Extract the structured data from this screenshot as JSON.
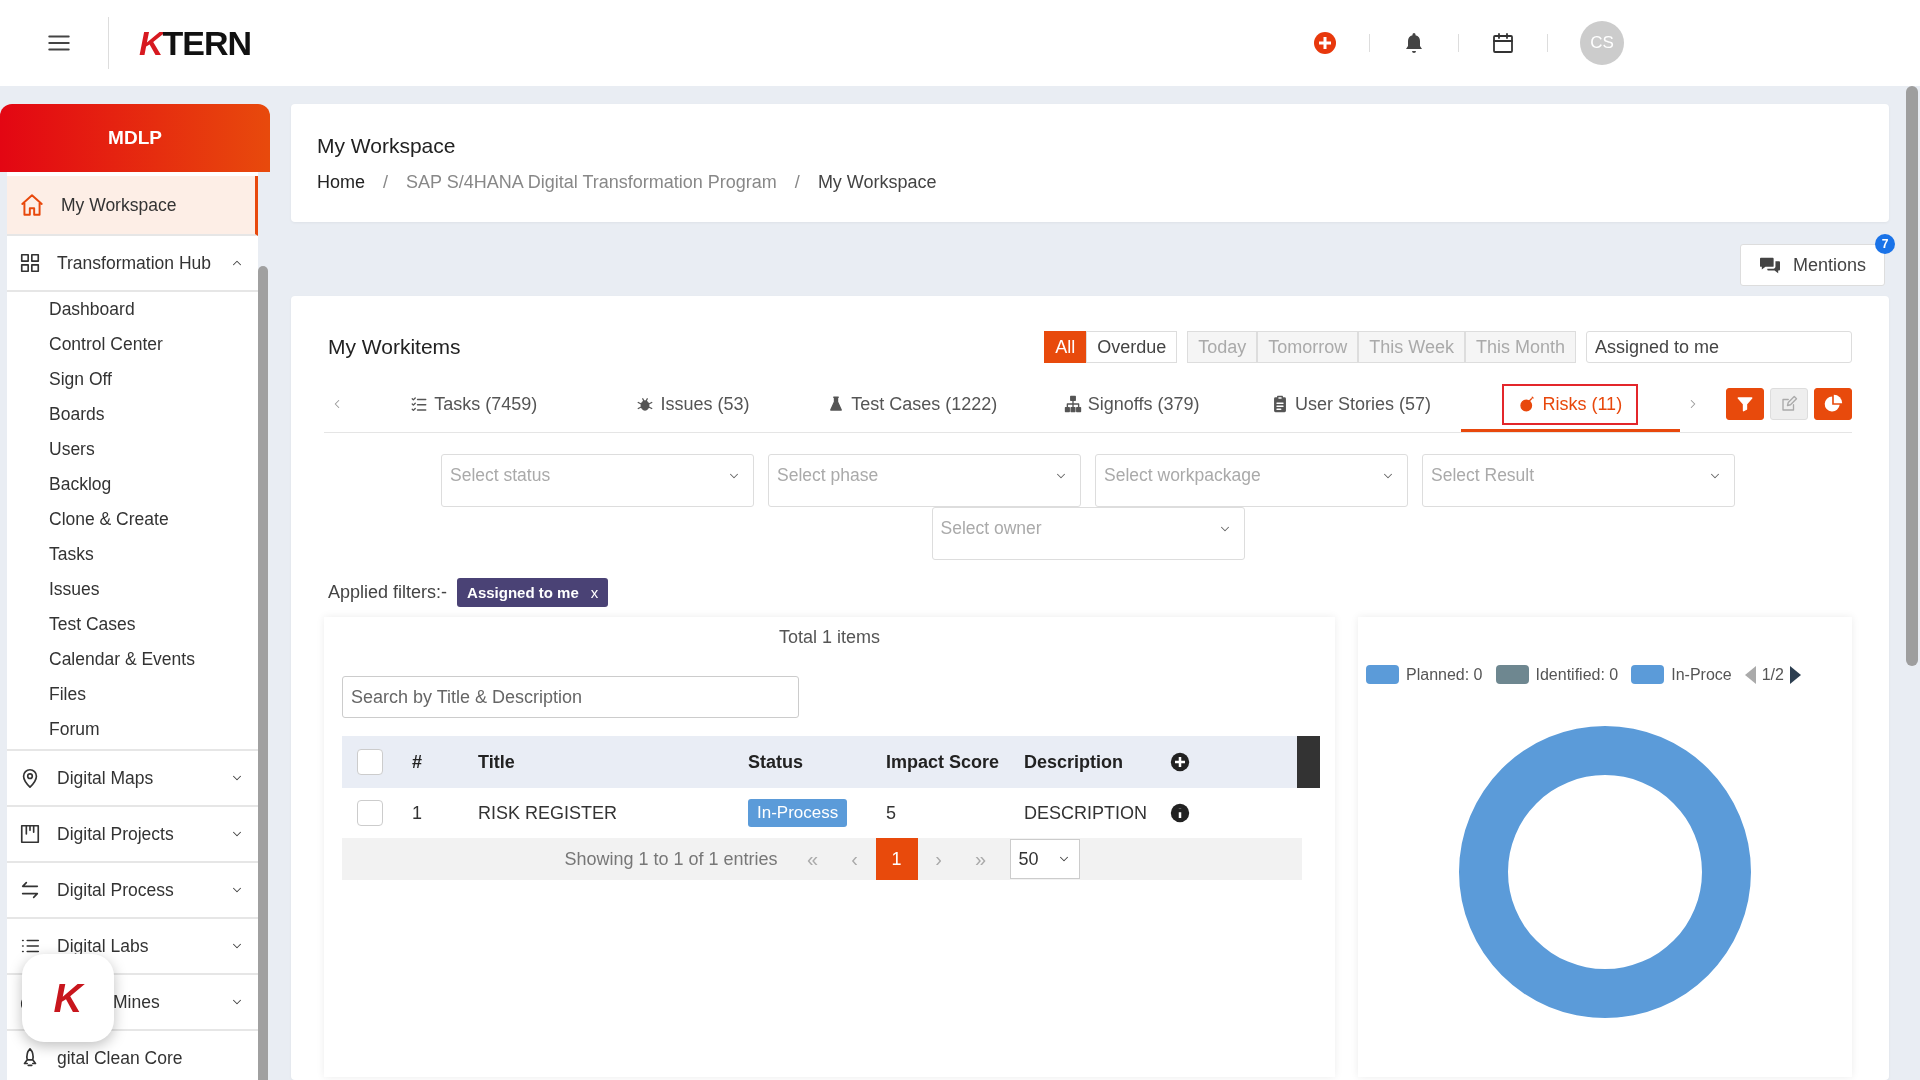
{
  "header": {
    "logo": "KTERN",
    "avatar": "CS"
  },
  "sidebar": {
    "brand": "MDLP",
    "items": [
      {
        "label": "My Workspace",
        "selected": true
      },
      {
        "label": "Transformation Hub",
        "selected": false,
        "expanded": true,
        "children": [
          {
            "label": "Dashboard",
            "selected": false
          },
          {
            "label": "Control Center",
            "selected": false
          },
          {
            "label": "Sign Off",
            "selected": false
          },
          {
            "label": "Boards",
            "selected": false
          },
          {
            "label": "Users",
            "selected": false
          },
          {
            "label": "Backlog",
            "selected": false
          },
          {
            "label": "Clone & Create",
            "selected": false
          },
          {
            "label": "Tasks",
            "selected": false
          },
          {
            "label": "Issues",
            "selected": false
          },
          {
            "label": "Test Cases",
            "selected": false
          },
          {
            "label": "Calendar & Events",
            "selected": false
          },
          {
            "label": "Files",
            "selected": false
          },
          {
            "label": "Forum",
            "selected": false
          }
        ]
      },
      {
        "label": "Digital Maps",
        "selected": false,
        "expanded": false
      },
      {
        "label": "Digital Projects",
        "selected": false,
        "expanded": false
      },
      {
        "label": "Digital Process",
        "selected": false,
        "expanded": false
      },
      {
        "label": "Digital Labs",
        "selected": false,
        "expanded": false
      },
      {
        "label": "Mines",
        "selected": false,
        "expanded": false
      },
      {
        "label": "gital Clean Core",
        "selected": false
      }
    ],
    "fab": "K"
  },
  "page": {
    "title": "My Workspace",
    "breadcrumb": [
      "Home",
      "SAP S/4HANA Digital Transformation Program",
      "My Workspace"
    ],
    "separator": "/"
  },
  "mentions": {
    "label": "Mentions",
    "badge": "7"
  },
  "workitems": {
    "title": "My Workitems",
    "due_filters": [
      {
        "label": "All",
        "selected": true
      },
      {
        "label": "Overdue",
        "selected": false
      }
    ],
    "range_filters": [
      {
        "label": "Today",
        "disabled": true
      },
      {
        "label": "Tomorrow",
        "disabled": true
      },
      {
        "label": "This Week",
        "disabled": true
      },
      {
        "label": "This Month",
        "disabled": true
      }
    ],
    "assignee": {
      "value": "Assigned to me"
    },
    "tabs": [
      {
        "label": "Tasks (7459)",
        "selected": false
      },
      {
        "label": "Issues (53)",
        "selected": false
      },
      {
        "label": "Test Cases (1222)",
        "selected": false
      },
      {
        "label": "Signoffs (379)",
        "selected": false
      },
      {
        "label": "User Stories (57)",
        "selected": false
      },
      {
        "label": "Risks (11)",
        "selected": true
      }
    ],
    "selects": [
      {
        "placeholder": "Select status"
      },
      {
        "placeholder": "Select phase"
      },
      {
        "placeholder": "Select workpackage"
      },
      {
        "placeholder": "Select Result"
      },
      {
        "placeholder": "Select owner"
      }
    ],
    "applied_filters": {
      "label": "Applied filters:-",
      "chips": [
        {
          "label": "Assigned to me",
          "close": "x"
        }
      ]
    },
    "total": "Total 1 items",
    "search": {
      "placeholder": "Search by Title & Description"
    },
    "table": {
      "header_checked": false,
      "columns": [
        "#",
        "Title",
        "Status",
        "Impact Score",
        "Description"
      ],
      "rows": [
        {
          "number": "1",
          "title": "RISK REGISTER",
          "status": "In-Process",
          "impact_score": "5",
          "description": "DESCRIPTION",
          "checked": false
        }
      ]
    },
    "pagination": {
      "summary": "Showing 1 to 1 of 1 entries",
      "first": "«",
      "prev": "‹",
      "pages": [
        {
          "label": "1",
          "selected": true
        }
      ],
      "next": "›",
      "last": "»",
      "page_size": "50"
    },
    "chart": {
      "legend": [
        {
          "label": "Planned: 0",
          "color": "#5b9bd9"
        },
        {
          "label": "Identified: 0",
          "color": "#6e8790"
        },
        {
          "label": "In-Proce",
          "color": "#5b9bd9"
        }
      ],
      "page": "1/2"
    }
  }
}
